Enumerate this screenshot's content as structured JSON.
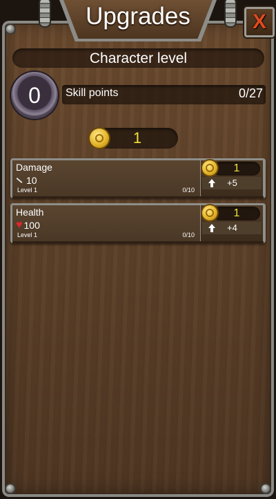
{
  "header": {
    "title": "Upgrades",
    "close_label": "X"
  },
  "character_level": {
    "label": "Character level",
    "level": "0"
  },
  "skill_points": {
    "label": "Skill points",
    "count": "0/27"
  },
  "currency": {
    "amount": "1"
  },
  "upgrades": [
    {
      "name": "Damage",
      "stat_value": "10",
      "stat_icon": "sword-icon",
      "level": "Level 1",
      "progress": "0/10",
      "cost": "1",
      "gain": "+5"
    },
    {
      "name": "Health",
      "stat_value": "100",
      "stat_icon": "heart-icon",
      "level": "Level 1",
      "progress": "0/10",
      "cost": "1",
      "gain": "+4"
    }
  ],
  "colors": {
    "wood": "#5d4129",
    "gold_text": "#f2e23a",
    "close_x": "#e04a1e",
    "heart": "#e3252e"
  }
}
